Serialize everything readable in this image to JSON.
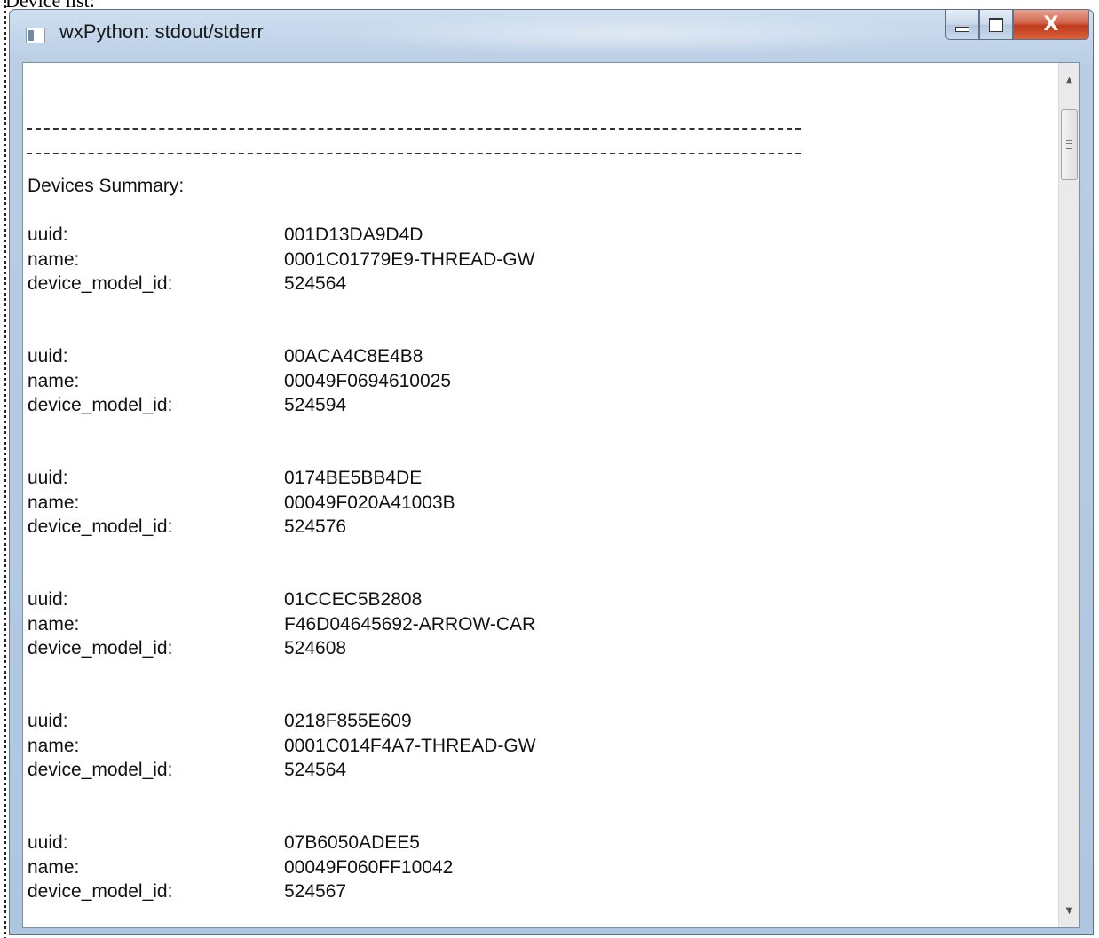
{
  "page_caption": "Device list:",
  "window": {
    "title": "wxPython: stdout/stderr",
    "buttons": {
      "minimize": "minimize",
      "maximize": "maximize",
      "close": "X"
    }
  },
  "output": {
    "separator": "------------------------------------------------------------------------------------------------------------------------------------------------------------------------",
    "summary_heading": "Devices Summary:",
    "field_labels": {
      "uuid": "uuid:",
      "name": "name:",
      "device_model_id": "device_model_id:"
    },
    "devices": [
      {
        "uuid": "001D13DA9D4D",
        "name": "0001C01779E9-THREAD-GW",
        "device_model_id": "524564"
      },
      {
        "uuid": "00ACA4C8E4B8",
        "name": "00049F0694610025",
        "device_model_id": "524594"
      },
      {
        "uuid": "0174BE5BB4DE",
        "name": "00049F020A41003B",
        "device_model_id": "524576"
      },
      {
        "uuid": "01CCEC5B2808",
        "name": "F46D04645692-ARROW-CAR",
        "device_model_id": "524608"
      },
      {
        "uuid": "0218F855E609",
        "name": "0001C014F4A7-THREAD-GW",
        "device_model_id": "524564"
      },
      {
        "uuid": "07B6050ADEE5",
        "name": "00049F060FF10042",
        "device_model_id": "524567"
      }
    ]
  },
  "scrollbar": {
    "up_arrow": "▲",
    "down_arrow": "▼"
  },
  "colors": {
    "window_frame": "#aec6e0",
    "close_button": "#c0391c",
    "text": "#111111"
  }
}
